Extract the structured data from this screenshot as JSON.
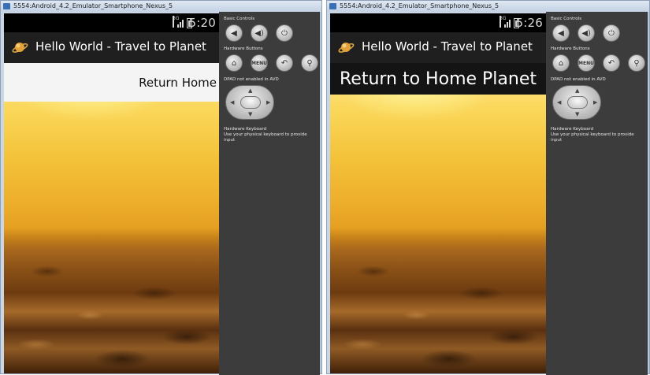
{
  "windows": [
    {
      "title": "5554:Android_4.2_Emulator_Smartphone_Nexus_5",
      "status": {
        "network": "3G",
        "time": "5:20"
      },
      "app_title": "Hello World - Travel to Planet",
      "button_label": "Return Home",
      "panel": {
        "basic_controls": "Basic Controls",
        "hardware_buttons": "Hardware Buttons",
        "menu_label": "MENU",
        "dpad_label": "DPAD not enabled in AVD",
        "keyboard_title": "Hardware Keyboard",
        "keyboard_hint": "Use your physical keyboard to provide input"
      }
    },
    {
      "title": "5554:Android_4.2_Emulator_Smartphone_Nexus_5",
      "status": {
        "network": "3G",
        "time": "5:26"
      },
      "app_title": "Hello World - Travel to Planet",
      "button_label": "Return to Home Planet",
      "panel": {
        "basic_controls": "Basic Controls",
        "hardware_buttons": "Hardware Buttons",
        "menu_label": "MENU",
        "dpad_label": "DPAD not enabled in AVD",
        "keyboard_title": "Hardware Keyboard",
        "keyboard_hint": "Use your physical keyboard to provide input"
      }
    }
  ],
  "colors": {
    "action_bar": "#1f1f1f",
    "panel": "#3c3c3c",
    "sky_top": "#ffe89a",
    "sky_mid": "#f4c33a",
    "ground": "#6d3b10"
  },
  "icons": [
    "planet-icon",
    "volume-down-icon",
    "volume-up-icon",
    "power-icon",
    "home-icon",
    "back-icon",
    "search-icon",
    "dpad-icon",
    "signal-icon",
    "battery-icon"
  ]
}
